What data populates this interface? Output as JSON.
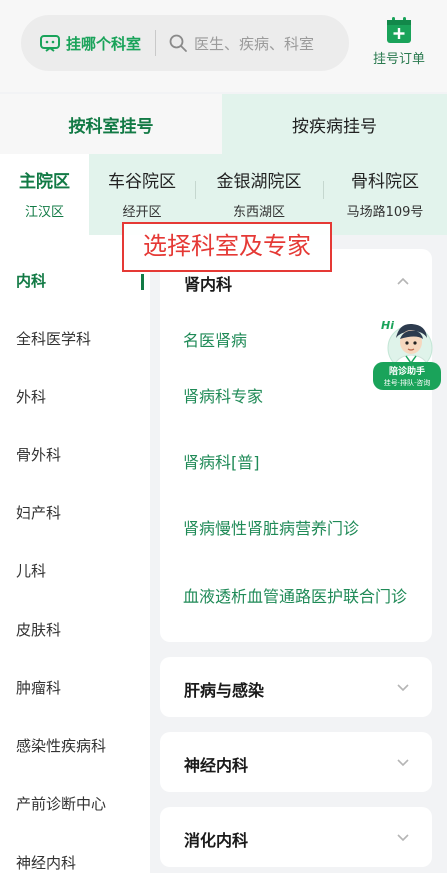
{
  "search": {
    "which_dept": "挂哪个科室",
    "placeholder": "医生、疾病、科室"
  },
  "order": {
    "label": "挂号订单"
  },
  "mode_tabs": [
    {
      "label": "按科室挂号"
    },
    {
      "label": "按疾病挂号"
    }
  ],
  "campuses": [
    {
      "name": "主院区",
      "addr": "江汉区"
    },
    {
      "name": "车谷院区",
      "addr": "经开区"
    },
    {
      "name": "金银湖院区",
      "addr": "东西湖区"
    },
    {
      "name": "骨科院区",
      "addr": "马场路109号"
    }
  ],
  "departments": [
    "内科",
    "全科医学科",
    "外科",
    "骨外科",
    "妇产科",
    "儿科",
    "皮肤科",
    "肿瘤科",
    "感染性疾病科",
    "产前诊断中心",
    "神经内科"
  ],
  "expanded": {
    "title": "肾内科",
    "items": [
      "名医肾病",
      "肾病科专家",
      "肾病科[普]",
      "肾病慢性肾脏病营养门诊",
      "血液透析血管通路医护联合门诊"
    ]
  },
  "collapsed": [
    "肝病与感染",
    "神经内科",
    "消化内科"
  ],
  "overlay": {
    "text": "选择科室及专家"
  },
  "helper": {
    "greeting": "Hi",
    "name": "陪诊助手",
    "sub": "挂号·排队·咨询"
  },
  "colors": {
    "accent": "#1aa35a",
    "accent_dark": "#127a45",
    "tab_bg": "#e2f3ec",
    "annotation": "#e53935"
  }
}
